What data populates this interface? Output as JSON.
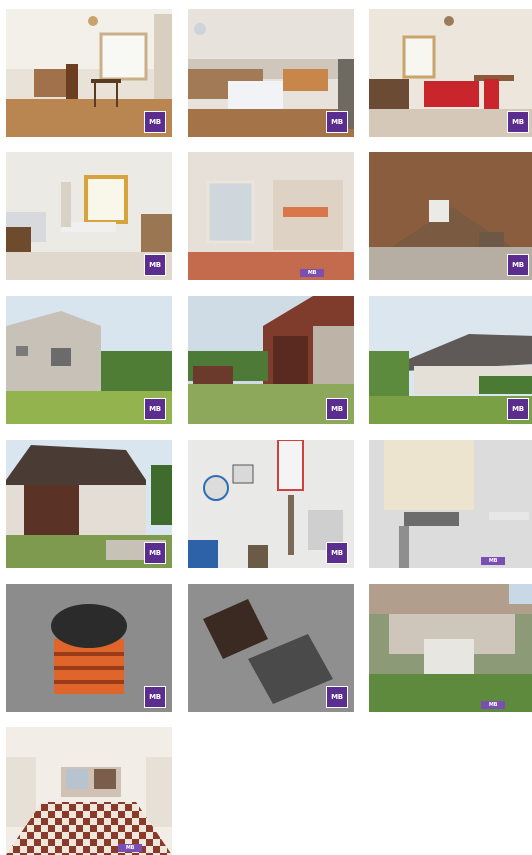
{
  "gallery": {
    "watermark": "MB",
    "accent": "#5b2d8e",
    "photos": [
      {
        "alt": "living room with dining table",
        "icon": "room-photo-icon"
      },
      {
        "alt": "kitchen with tablecloth table",
        "icon": "room-photo-icon"
      },
      {
        "alt": "living room with red sofa",
        "icon": "room-photo-icon"
      },
      {
        "alt": "kitchen with window",
        "icon": "room-photo-icon"
      },
      {
        "alt": "hallway with glass door",
        "icon": "room-photo-icon"
      },
      {
        "alt": "attic roof beams",
        "icon": "room-photo-icon"
      },
      {
        "alt": "house side with garden",
        "icon": "exterior-photo-icon"
      },
      {
        "alt": "barn and yard",
        "icon": "exterior-photo-icon"
      },
      {
        "alt": "house with roof and garden",
        "icon": "exterior-photo-icon"
      },
      {
        "alt": "barn with wooden doors",
        "icon": "exterior-photo-icon"
      },
      {
        "alt": "boiler room with pipes",
        "icon": "utility-photo-icon"
      },
      {
        "alt": "gas boiler on wall",
        "icon": "utility-photo-icon"
      },
      {
        "alt": "septic tank lid",
        "icon": "utility-photo-icon"
      },
      {
        "alt": "manhole covers in gravel",
        "icon": "utility-photo-icon"
      },
      {
        "alt": "street view of house",
        "icon": "exterior-photo-icon"
      },
      {
        "alt": "room with checkered floor",
        "icon": "room-photo-icon"
      }
    ]
  }
}
